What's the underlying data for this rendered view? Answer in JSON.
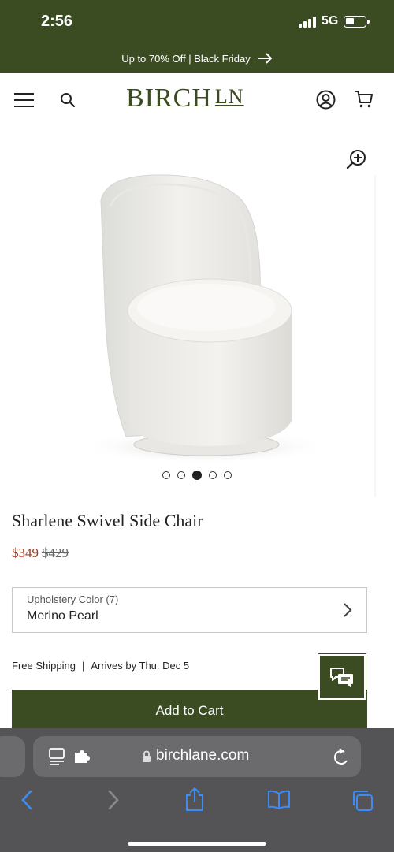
{
  "status_bar": {
    "time": "2:56",
    "network": "5G",
    "battery_level": 0.45
  },
  "promo": {
    "text": "Up to 70% Off | Black Friday"
  },
  "header": {
    "logo_main": "BIRCH",
    "logo_suffix": "LN"
  },
  "gallery": {
    "image_count": 5,
    "active_index": 2
  },
  "product": {
    "title": "Sharlene Swivel Side Chair",
    "sale_price": "$349",
    "original_price": "$429",
    "option_label": "Upholstery Color (7)",
    "option_value": "Merino Pearl",
    "shipping": "Free Shipping",
    "separator": "|",
    "arrival": "Arrives by Thu. Dec 5",
    "add_to_cart": "Add to Cart"
  },
  "browser": {
    "url": "birchlane.com"
  },
  "colors": {
    "brand_green": "#3b4c22",
    "sale_red": "#a33a22",
    "safari_toolbar": "#545456",
    "safari_accent": "#3d8bf5"
  },
  "icons": [
    "menu-icon",
    "search-icon",
    "account-icon",
    "cart-icon",
    "zoom-in-icon",
    "chevron-right-icon",
    "chat-icon",
    "page-menu-icon",
    "extension-icon",
    "lock-icon",
    "reload-icon",
    "back-icon",
    "forward-icon",
    "share-icon",
    "bookmarks-icon",
    "tabs-icon"
  ]
}
